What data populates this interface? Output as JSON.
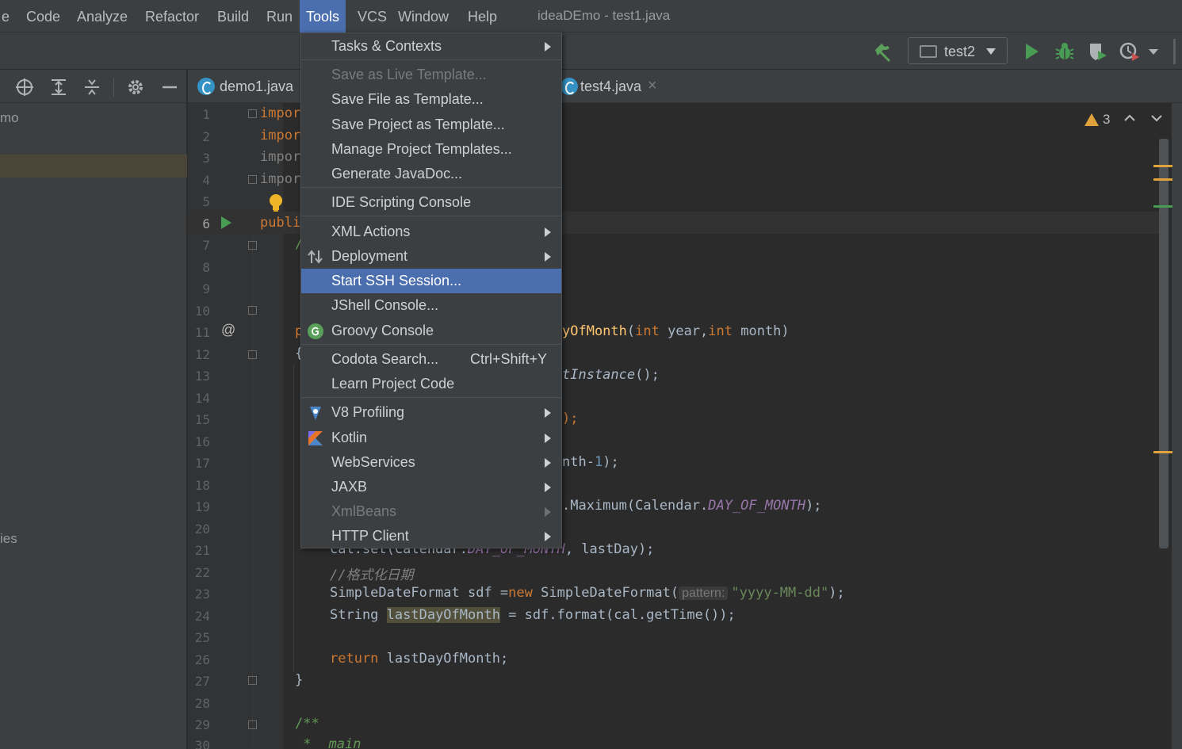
{
  "window": {
    "title": "ideaDEmo - test1.java"
  },
  "menubar": {
    "items": [
      {
        "label": "e",
        "key": "view"
      },
      {
        "label": "Code",
        "key": "code"
      },
      {
        "label": "Analyze",
        "key": "analyze"
      },
      {
        "label": "Refactor",
        "key": "refactor"
      },
      {
        "label": "Build",
        "key": "build"
      },
      {
        "label": "Run",
        "key": "run"
      },
      {
        "label": "Tools",
        "key": "tools",
        "active": true
      },
      {
        "label": "VCS",
        "key": "vcs"
      },
      {
        "label": "Window",
        "key": "window"
      },
      {
        "label": "Help",
        "key": "help"
      }
    ]
  },
  "toolbar": {
    "run_config": "test2",
    "icons": [
      "hammer-build-icon",
      "run-icon",
      "debug-bug-icon",
      "coverage-icon",
      "profiler-icon",
      "more-actions-chevron-icon"
    ]
  },
  "project_panel": {
    "icons": [
      "locate-crosshair-icon",
      "expand-all-icon",
      "collapse-all-icon",
      "settings-gear-icon",
      "hide-minus-icon"
    ],
    "row_top_text": "mo",
    "row_bottom_text": "ies"
  },
  "tabs": [
    {
      "label": "demo1.java"
    },
    {
      "label": "test4.java",
      "close": "×"
    }
  ],
  "editor": {
    "line_numbers": [
      "1",
      "2",
      "3",
      "4",
      "5",
      "6",
      "7",
      "8",
      "9",
      "10",
      "11",
      "12",
      "13",
      "14",
      "15",
      "16",
      "17",
      "18",
      "19",
      "20",
      "21",
      "22",
      "23",
      "24",
      "25",
      "26",
      "27",
      "28",
      "29",
      "30"
    ],
    "gutter_annotation": "@",
    "warnings_count": "3",
    "code": {
      "l1": "impor",
      "l2": "impor",
      "l3": "impor",
      "l4": "impor",
      "l6": "publi",
      "l7": "/",
      "l11_a": "p",
      "l11_method": "yOfMonth",
      "l11_args_a": "(",
      "l11_int1": "int",
      "l11_year": " year,",
      "l11_int2": "int",
      "l11_month": " month)",
      "l12": "{",
      "l13_a": "tInstance",
      "l13_b": "();",
      "l15": ");",
      "l17_a": "nth-",
      "l17_num": "1",
      "l17_b": ");",
      "l19_a": ".Maximum(Calendar.",
      "l19_field": "DAY_OF_MONTH",
      "l19_b": ");",
      "l21_a": "cal.set(Calendar.",
      "l21_field": "DAY_OF_MONTH",
      "l21_b": ", lastDay);",
      "l22_comment": "//格式化日期",
      "l23_a": "SimpleDateFormat sdf =",
      "l23_new": "new",
      "l23_b": " SimpleDateFormat(",
      "l23_hint": "pattern:",
      "l23_str": "\"yyyy-MM-dd\"",
      "l23_c": ");",
      "l24_a": "String ",
      "l24_var": "lastDayOfMonth",
      "l24_b": " = sdf.format(cal.getTime());",
      "l26_return": "return",
      "l26_b": " lastDayOfMonth;",
      "l27": "}",
      "l29": "/**",
      "l30_a": " *",
      "l30_b": "main"
    }
  },
  "tools_menu": {
    "items": [
      {
        "label": "Tasks & Contexts",
        "submenu": true
      },
      {
        "label": "Save as Live Template...",
        "disabled": true
      },
      {
        "label": "Save File as Template..."
      },
      {
        "label": "Save Project as Template..."
      },
      {
        "label": "Manage Project Templates..."
      },
      {
        "label": "Generate JavaDoc..."
      },
      {
        "label": "IDE Scripting Console"
      },
      {
        "label": "XML Actions",
        "submenu": true
      },
      {
        "label": "Deployment",
        "submenu": true,
        "icon": "deployment-arrows-icon"
      },
      {
        "label": "Start SSH Session...",
        "selected": true
      },
      {
        "label": "JShell Console..."
      },
      {
        "label": "Groovy Console",
        "icon": "groovy-icon"
      },
      {
        "label": "Codota Search...",
        "shortcut": "Ctrl+Shift+Y"
      },
      {
        "label": "Learn Project Code"
      },
      {
        "label": "V8 Profiling",
        "submenu": true,
        "icon": "v8-profiling-icon"
      },
      {
        "label": "Kotlin",
        "submenu": true,
        "icon": "kotlin-icon"
      },
      {
        "label": "WebServices",
        "submenu": true
      },
      {
        "label": "JAXB",
        "submenu": true
      },
      {
        "label": "XmlBeans",
        "submenu": true,
        "disabled": true
      },
      {
        "label": "HTTP Client",
        "submenu": true
      }
    ]
  },
  "colors": {
    "selection": "#4b6eaf",
    "keyword": "#cc7832",
    "method": "#ffc66d",
    "field": "#9876aa",
    "string": "#6a8759",
    "warning": "#e0a23c"
  }
}
